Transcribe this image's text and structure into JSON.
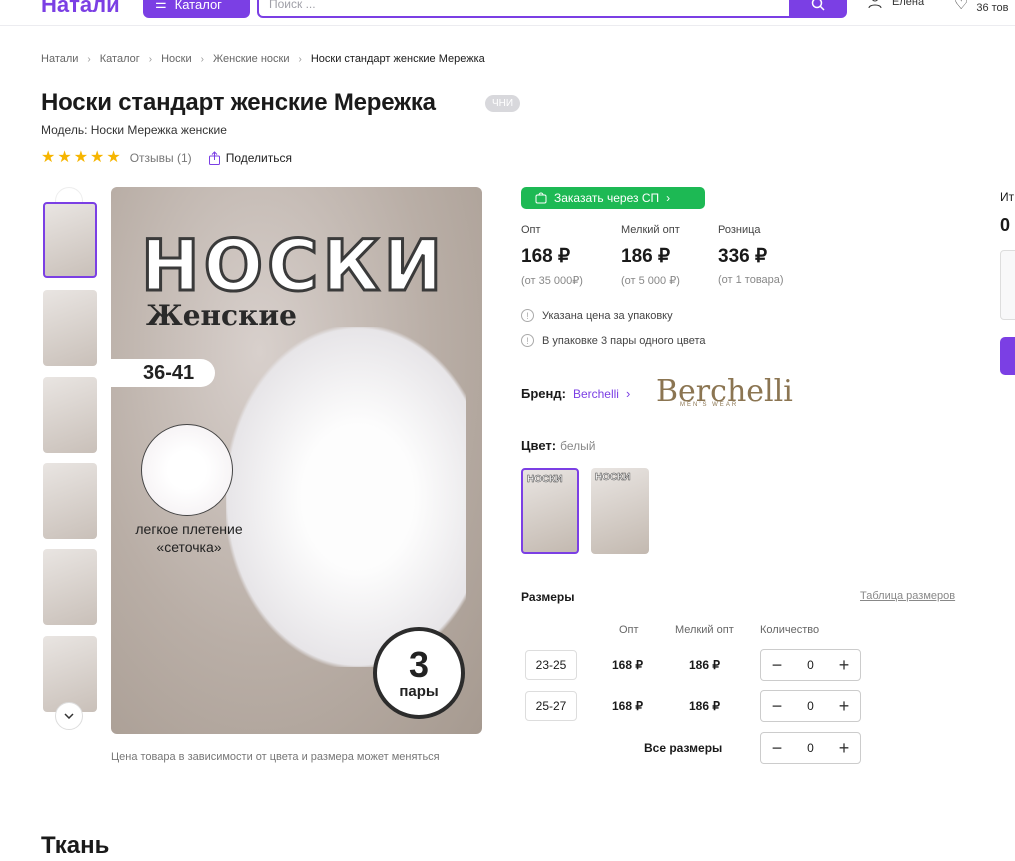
{
  "header": {
    "logo": "Натали",
    "catalog": "Каталог",
    "search_placeholder": "Поиск ...",
    "user": "Елена",
    "fav_count": "36 тов"
  },
  "breadcrumbs": [
    "Натали",
    "Каталог",
    "Носки",
    "Женские носки",
    "Носки стандарт женские Мережка"
  ],
  "product": {
    "title": "Носки стандарт женские Мережка",
    "badge": "ЧНИ",
    "model": "Модель: Носки Мережка женские",
    "reviews": "Отзывы (1)",
    "share": "Поделиться",
    "rating": 5
  },
  "image": {
    "title": "НОСКИ",
    "subtitle": "Женские",
    "size": "36-41",
    "texture": "легкое плетение «сеточка»",
    "pairs_num": "3",
    "pairs_word": "пары",
    "caption": "Цена товара в зависимости от цвета и размера может меняться"
  },
  "order_sp": "Заказать через СП",
  "prices": [
    {
      "label": "Опт",
      "value": "168 ₽",
      "note": "(от 35 000₽)"
    },
    {
      "label": "Мелкий опт",
      "value": "186 ₽",
      "note": "(от 5 000 ₽)"
    },
    {
      "label": "Розница",
      "value": "336 ₽",
      "note": "(от 1 товара)"
    }
  ],
  "info": [
    "Указана цена за упаковку",
    "В упаковке 3 пары одного цвета"
  ],
  "brand": {
    "label": "Бренд:",
    "name": "Berchelli",
    "logo": "Berchelli",
    "logo_sub": "MEN'S WEAR"
  },
  "color": {
    "label": "Цвет:",
    "value": "белый",
    "swatch_text": "НОСКИ"
  },
  "sizes": {
    "title": "Размеры",
    "table_link": "Таблица размеров",
    "headers": [
      "Опт",
      "Мелкий опт",
      "Количество"
    ],
    "rows": [
      {
        "size": "23-25",
        "opt": "168 ₽",
        "small": "186 ₽",
        "qty": "0"
      },
      {
        "size": "25-27",
        "opt": "168 ₽",
        "small": "186 ₽",
        "qty": "0"
      }
    ],
    "all_label": "Все размеры",
    "all_qty": "0"
  },
  "right": {
    "label": "Ит",
    "value": "0"
  },
  "section_title": "Ткань"
}
